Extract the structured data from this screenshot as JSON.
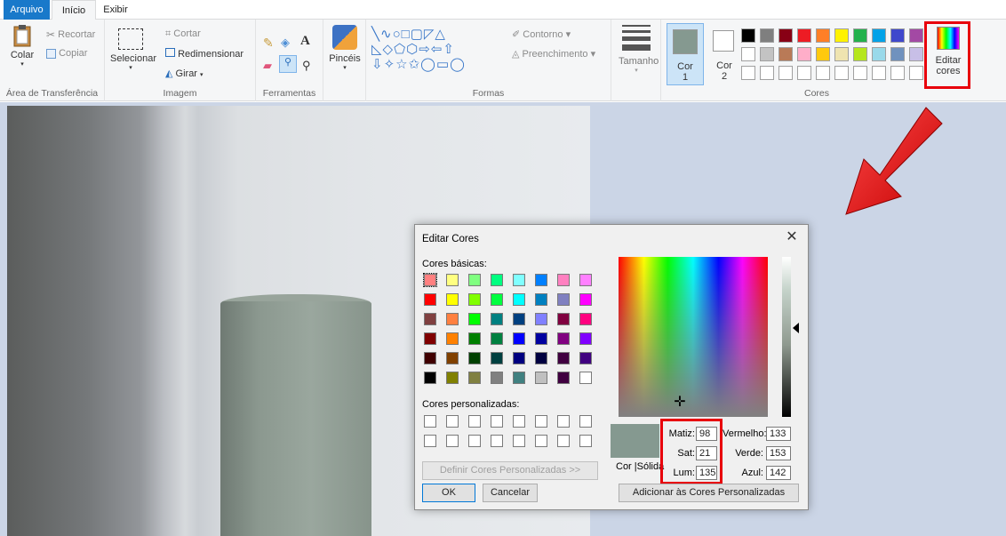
{
  "tabs": {
    "file": "Arquivo",
    "home": "Início",
    "view": "Exibir"
  },
  "clipboard": {
    "paste": "Colar",
    "cut": "Recortar",
    "copy": "Copiar",
    "group": "Área de Transferência"
  },
  "image": {
    "select": "Selecionar",
    "crop": "Cortar",
    "resize": "Redimensionar",
    "rotate": "Girar",
    "group": "Imagem"
  },
  "tools": {
    "group": "Ferramentas"
  },
  "brushes": {
    "label": "Pincéis"
  },
  "shapes": {
    "outline": "Contorno",
    "fill": "Preenchimento",
    "group": "Formas"
  },
  "size": {
    "label": "Tamanho"
  },
  "colors": {
    "color1_line1": "Cor",
    "color1_line2": "1",
    "color2_line1": "Cor",
    "color2_line2": "2",
    "group": "Cores",
    "edit_line1": "Editar",
    "edit_line2": "cores",
    "color1_value": "#859990",
    "palette_row1": [
      "#000000",
      "#7f7f7f",
      "#880015",
      "#ed1c24",
      "#ff7f27",
      "#fff200",
      "#22b14c",
      "#00a2e8",
      "#3f48cc",
      "#a349a4"
    ],
    "palette_row2": [
      "#ffffff",
      "#c3c3c3",
      "#b97a57",
      "#ffaec9",
      "#ffc90e",
      "#efe4b0",
      "#b5e61d",
      "#99d9ea",
      "#7092be",
      "#c8bfe7"
    ]
  },
  "dialog": {
    "title": "Editar Cores",
    "basic_label": "Cores básicas:",
    "custom_label": "Cores personalizadas:",
    "define_button": "Definir Cores Personalizadas >>",
    "ok": "OK",
    "cancel": "Cancelar",
    "solid_label": "Cor |Sólida",
    "hue_label": "Matiz:",
    "hue": "98",
    "sat_label": "Sat:",
    "sat": "21",
    "lum_label": "Lum:",
    "lum": "135",
    "red_label": "Vermelho:",
    "red": "133",
    "green_label": "Verde:",
    "green": "153",
    "blue_label": "Azul:",
    "blue": "142",
    "add_button": "Adicionar às Cores Personalizadas",
    "preview_color": "#859990",
    "basic_colors": [
      [
        "#ff8080",
        "#ffff80",
        "#80ff80",
        "#00ff80",
        "#80ffff",
        "#0080ff",
        "#ff80c0",
        "#ff80ff"
      ],
      [
        "#ff0000",
        "#ffff00",
        "#80ff00",
        "#00ff40",
        "#00ffff",
        "#0080c0",
        "#8080c0",
        "#ff00ff"
      ],
      [
        "#804040",
        "#ff8040",
        "#00ff00",
        "#008080",
        "#004080",
        "#8080ff",
        "#800040",
        "#ff0080"
      ],
      [
        "#800000",
        "#ff8000",
        "#008000",
        "#008040",
        "#0000ff",
        "#0000a0",
        "#800080",
        "#8000ff"
      ],
      [
        "#400000",
        "#804000",
        "#004000",
        "#004040",
        "#000080",
        "#000040",
        "#400040",
        "#400080"
      ],
      [
        "#000000",
        "#808000",
        "#808040",
        "#808080",
        "#408080",
        "#c0c0c0",
        "#400040",
        "#ffffff"
      ]
    ]
  }
}
